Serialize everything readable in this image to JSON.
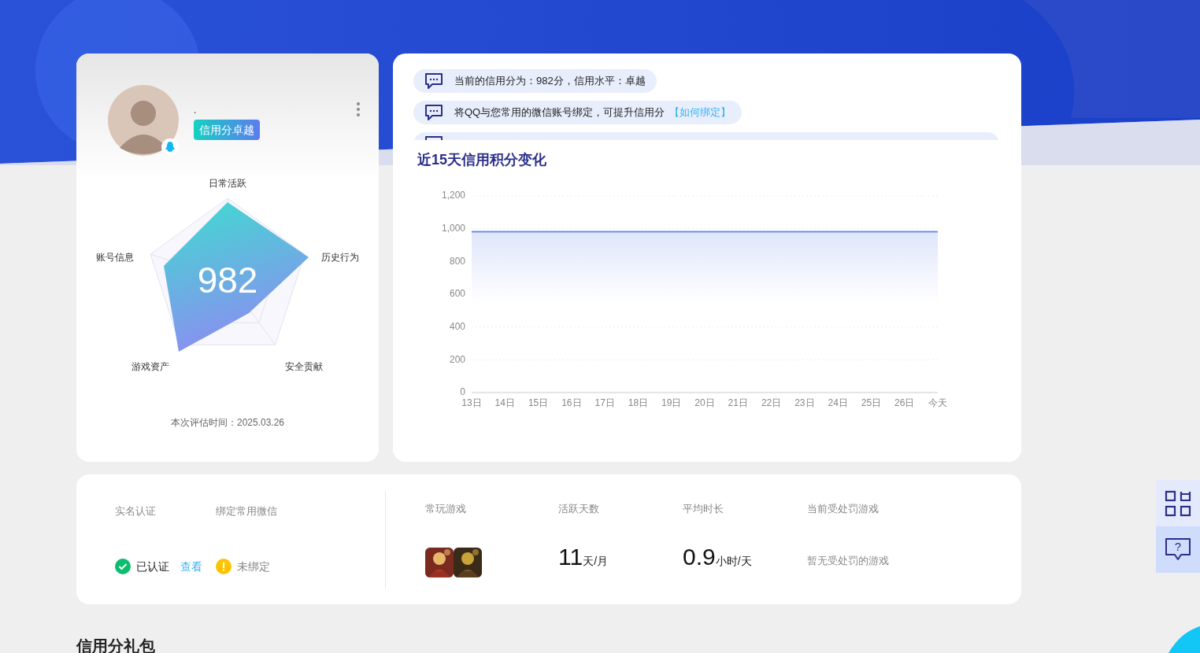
{
  "profile": {
    "name": ".",
    "badge": "信用分卓越"
  },
  "radar": {
    "score": "982",
    "axes": [
      "日常活跃",
      "历史行为",
      "安全贡献",
      "游戏资产",
      "账号信息"
    ],
    "eval_time": "本次评估时间：2025.03.26"
  },
  "notices": [
    {
      "text": "当前的信用分为：982分，信用水平：卓越"
    },
    {
      "text": "将QQ与您常用的微信账号绑定，可提升信用分",
      "link": "【如何绑定】"
    },
    {
      "kind": "cut"
    }
  ],
  "trend": {
    "title": "近15天信用积分变化",
    "chart_data": {
      "type": "area",
      "categories": [
        "13日",
        "14日",
        "15日",
        "16日",
        "17日",
        "18日",
        "19日",
        "20日",
        "21日",
        "22日",
        "23日",
        "24日",
        "25日",
        "26日",
        "今天"
      ],
      "grid": true,
      "series": [
        {
          "color": "#6f8fe8",
          "values": [
            982,
            982,
            982,
            982,
            982,
            982,
            982,
            982,
            982,
            982,
            982,
            982,
            982,
            982,
            982
          ]
        }
      ],
      "ylim": [
        0,
        1200
      ],
      "yticks": [
        {
          "value": 0,
          "label": "0"
        },
        {
          "value": 200,
          "label": "200"
        },
        {
          "value": 400,
          "label": "400"
        },
        {
          "value": 600,
          "label": "600"
        },
        {
          "value": 800,
          "label": "800"
        },
        {
          "value": 1000,
          "label": "1,000"
        },
        {
          "value": 1200,
          "label": "1,200"
        }
      ]
    }
  },
  "account": [
    {
      "label": "实名认证",
      "status": "已认证",
      "kind": "ok",
      "link": "查看"
    },
    {
      "label": "绑定常用微信",
      "status": "未绑定",
      "kind": "warn"
    }
  ],
  "games": {
    "label": "常玩游戏"
  },
  "metrics": [
    {
      "label": "活跃天数",
      "value": "11",
      "unit": "天/月"
    },
    {
      "label": "平均时长",
      "value": "0.9",
      "unit": "小时/天"
    }
  ],
  "penalty": {
    "label": "当前受处罚游戏",
    "text": "暂无受处罚的游戏"
  },
  "section_title": "信用分礼包",
  "side_buttons": [
    {
      "kind": "qr"
    },
    {
      "kind": "help",
      "label": "?"
    }
  ]
}
